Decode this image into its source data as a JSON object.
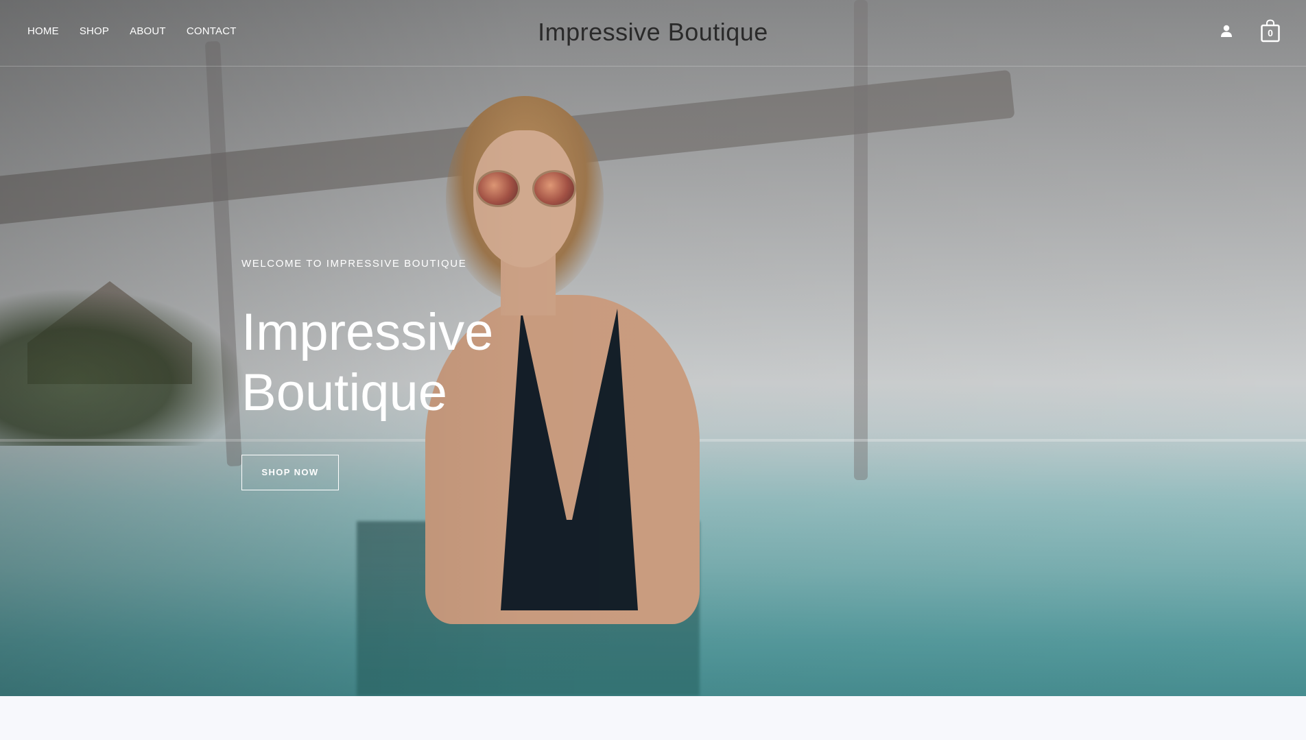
{
  "header": {
    "nav": [
      {
        "label": "HOME"
      },
      {
        "label": "SHOP"
      },
      {
        "label": "ABOUT"
      },
      {
        "label": "CONTACT"
      }
    ],
    "brand": "Impressive Boutique",
    "icons": {
      "account": "user-icon",
      "cart": "shopping-bag-icon"
    },
    "cart_count": "0"
  },
  "hero": {
    "eyebrow": "WELCOME TO IMPRESSIVE BOUTIQUE",
    "title": "Impressive Boutique",
    "cta_label": "SHOP NOW"
  },
  "colors": {
    "text_light": "#ffffff",
    "brand_text": "#2a2a2a",
    "page_bg": "#f7f8fc"
  }
}
